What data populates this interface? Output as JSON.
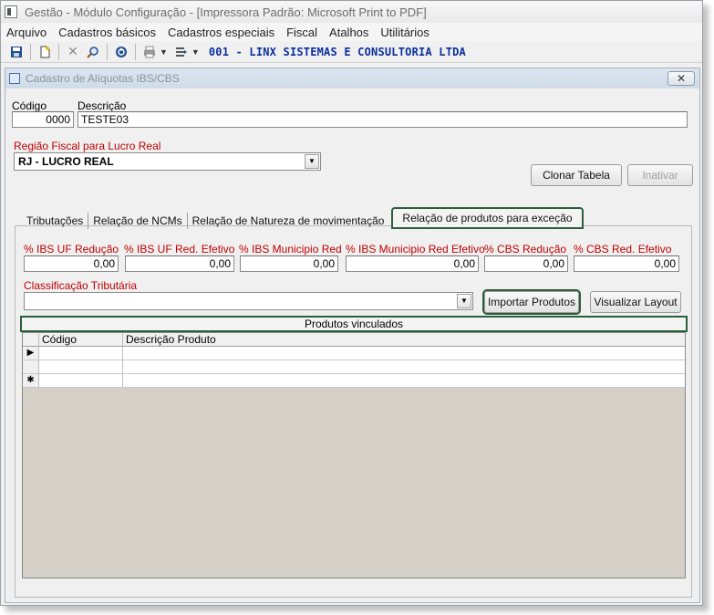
{
  "window": {
    "title": "Gestão  - Módulo Configuração - [Impressora Padrão: Microsoft Print to PDF]"
  },
  "menu": [
    "Arquivo",
    "Cadastros básicos",
    "Cadastros especiais",
    "Fiscal",
    "Atalhos",
    "Utilitários"
  ],
  "toolbar": {
    "company": "001 - LINX SISTEMAS E CONSULTORIA LTDA",
    "icons": [
      "save-icon",
      "new-document-icon",
      "delete-icon",
      "search-icon",
      "power-icon",
      "print-icon",
      "list-icon"
    ]
  },
  "form": {
    "title": "Cadastro de Alíquotas IBS/CBS",
    "codigo_label": "Código",
    "codigo_value": "0000",
    "descricao_label": "Descrição",
    "descricao_value": "TESTE03",
    "regiao_label": "Região Fiscal para Lucro Real",
    "regiao_value": "RJ - LUCRO REAL",
    "clonar_button": "Clonar Tabela",
    "inativar_button": "Inativar"
  },
  "tabs": [
    "Tributações",
    "Relação de NCMs",
    "Relação de Natureza de movimentação",
    "Relação de produtos para exceção"
  ],
  "exception_tab": {
    "fields": [
      {
        "label": "% IBS UF Redução",
        "value": "0,00"
      },
      {
        "label": "% IBS UF Red. Efetivo",
        "value": "0,00"
      },
      {
        "label": "% IBS Municipio Red",
        "value": "0,00"
      },
      {
        "label": "% IBS Municipio Red Efetivo",
        "value": "0,00"
      },
      {
        "label": "% CBS Redução",
        "value": "0,00"
      },
      {
        "label": "% CBS Red. Efetivo",
        "value": "0,00"
      }
    ],
    "classificacao_label": "Classificação Tributária",
    "classificacao_value": "",
    "importar_button": "Importar Produtos",
    "visualizar_button": "Visualizar Layout",
    "grid_title": "Produtos vinculados",
    "columns": [
      "Código",
      "Descrição Produto"
    ],
    "row_indicators": [
      "▶",
      "",
      "✱"
    ]
  }
}
